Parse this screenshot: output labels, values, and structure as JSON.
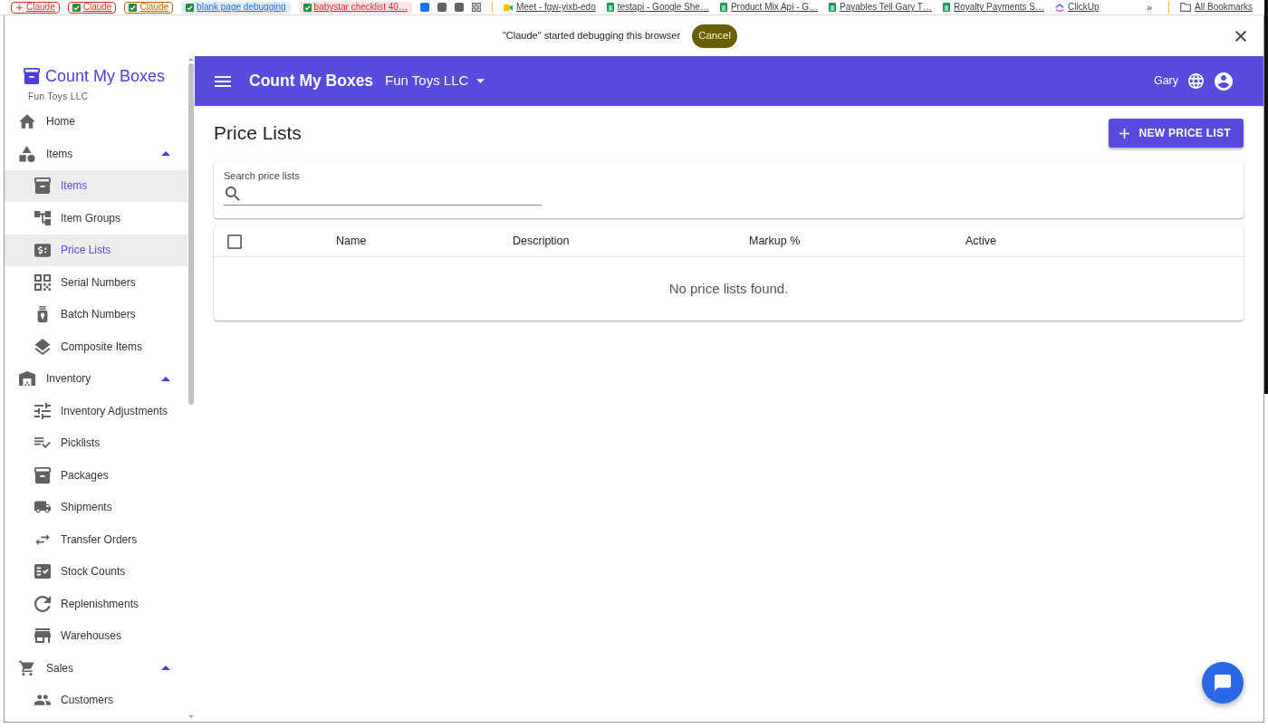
{
  "bookmarks": [
    {
      "kind": "group",
      "label": "Claude",
      "color": "#d93025"
    },
    {
      "kind": "group",
      "label": "Claude",
      "color": "#d93025"
    },
    {
      "kind": "group",
      "label": "Claude",
      "color": "#c26401"
    },
    {
      "kind": "tinted",
      "label": "blank page debugging",
      "color": "#1a73e8"
    },
    {
      "kind": "tinted",
      "label": "babystar checklist 40…",
      "color": "#d93025"
    },
    {
      "kind": "icon"
    },
    {
      "kind": "icon"
    },
    {
      "kind": "icon"
    },
    {
      "kind": "icon"
    },
    {
      "kind": "link",
      "label": "Meet - fgw-yixb-edo"
    },
    {
      "kind": "link",
      "label": "testapi - Google She…"
    },
    {
      "kind": "link",
      "label": "Product Mix Api - G…"
    },
    {
      "kind": "link",
      "label": "Payables Tell Gary T…"
    },
    {
      "kind": "link",
      "label": "Royalty Payments S…"
    },
    {
      "kind": "link",
      "label": "ClickUp"
    }
  ],
  "bookmarks_overflow": "»",
  "all_bookmarks": "All Bookmarks",
  "debug_bar": {
    "message": "\"Claude\" started debugging this browser",
    "button": "Cancel"
  },
  "sidebar": {
    "brand": "Count My Boxes",
    "organization": "Fun Toys LLC",
    "items": [
      {
        "label": "Home",
        "selected": false
      },
      {
        "label": "Items",
        "selected": false,
        "expanded": true,
        "children": [
          {
            "label": "Items",
            "selected": true
          },
          {
            "label": "Item Groups",
            "selected": false
          },
          {
            "label": "Price Lists",
            "selected": true
          },
          {
            "label": "Serial Numbers",
            "selected": false
          },
          {
            "label": "Batch Numbers",
            "selected": false
          },
          {
            "label": "Composite Items",
            "selected": false
          }
        ]
      },
      {
        "label": "Inventory",
        "selected": false,
        "expanded": true,
        "children": [
          {
            "label": "Inventory Adjustments",
            "selected": false
          },
          {
            "label": "Picklists",
            "selected": false
          },
          {
            "label": "Packages",
            "selected": false
          },
          {
            "label": "Shipments",
            "selected": false
          },
          {
            "label": "Transfer Orders",
            "selected": false
          },
          {
            "label": "Stock Counts",
            "selected": false
          },
          {
            "label": "Replenishments",
            "selected": false
          },
          {
            "label": "Warehouses",
            "selected": false
          }
        ]
      },
      {
        "label": "Sales",
        "selected": false,
        "expanded": true,
        "children": [
          {
            "label": "Customers",
            "selected": false
          }
        ]
      }
    ]
  },
  "app_bar": {
    "title": "Count My Boxes",
    "organization": "Fun Toys LLC",
    "user": "Gary"
  },
  "page": {
    "title": "Price Lists",
    "new_button": "NEW PRICE LIST",
    "search": {
      "label": "Search price lists"
    },
    "table": {
      "select_all": {
        "checked": false
      },
      "columns": [
        "Name",
        "Description",
        "Markup %",
        "Active"
      ],
      "empty_message": "No price lists found."
    }
  }
}
